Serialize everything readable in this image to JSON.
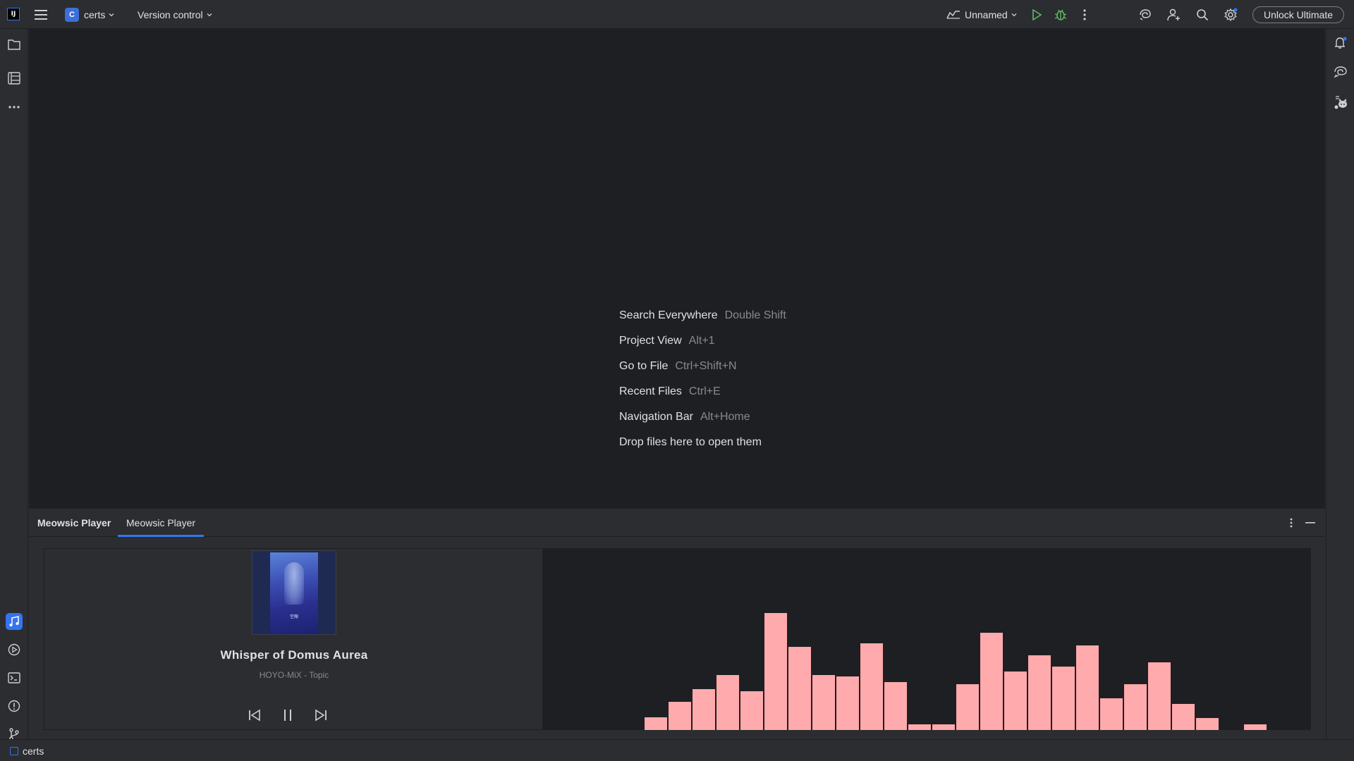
{
  "titlebar": {
    "logo_text": "IJ",
    "project_badge": "C",
    "project_name": "certs",
    "vcs_label": "Version control",
    "run_config": "Unnamed",
    "unlock_label": "Unlock Ultimate"
  },
  "editor": {
    "hints": [
      {
        "label": "Search Everywhere",
        "key": "Double Shift"
      },
      {
        "label": "Project View",
        "key": "Alt+1"
      },
      {
        "label": "Go to File",
        "key": "Ctrl+Shift+N"
      },
      {
        "label": "Recent Files",
        "key": "Ctrl+E"
      },
      {
        "label": "Navigation Bar",
        "key": "Alt+Home"
      },
      {
        "label": "Drop files here to open them",
        "key": ""
      }
    ]
  },
  "tool_window": {
    "title": "Meowsic Player",
    "tab_label": "Meowsic Player",
    "track_title": "Whisper of Domus Aurea",
    "track_artist": "HOYO-MiX - Topic",
    "cover_text": "空隙",
    "playback_state": "playing"
  },
  "visualizer": {
    "bar_color": "#ffaaac",
    "levels": [
      0.0,
      0.0,
      0.0,
      0.0,
      0.11,
      0.24,
      0.35,
      0.47,
      0.33,
      1.0,
      0.71,
      0.47,
      0.46,
      0.74,
      0.41,
      0.05,
      0.05,
      0.39,
      0.83,
      0.5,
      0.64,
      0.54,
      0.72,
      0.27,
      0.39,
      0.58,
      0.22,
      0.1,
      0.0,
      0.05,
      0.0,
      0.0
    ]
  },
  "statusbar": {
    "project": "certs"
  },
  "colors": {
    "accent": "#3574f0",
    "run_green": "#5fb865"
  }
}
